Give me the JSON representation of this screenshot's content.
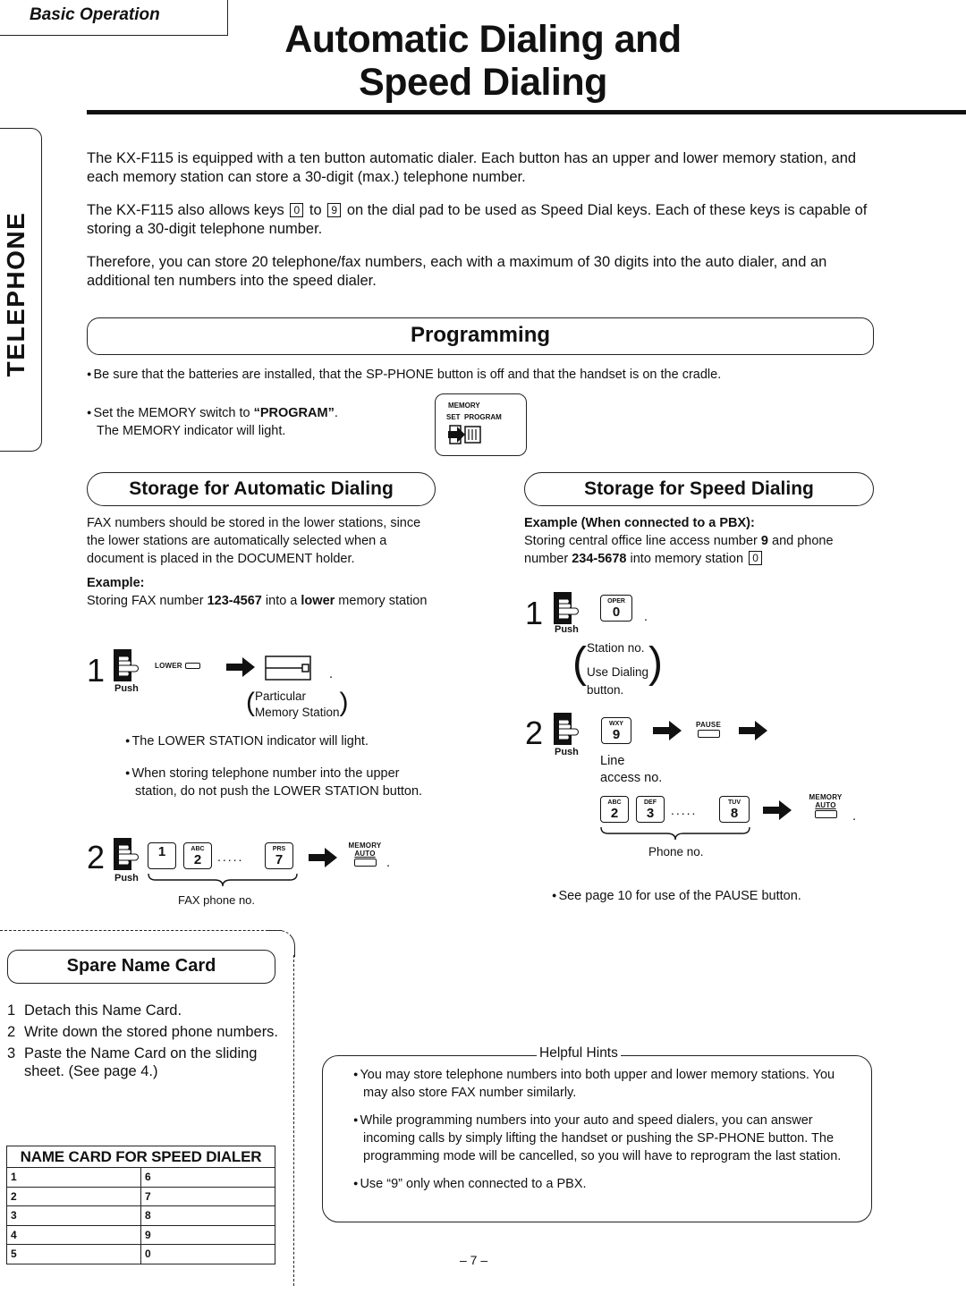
{
  "header": {
    "section_tab": "Basic Operation",
    "title_line1": "Automatic Dialing and",
    "title_line2": "Speed Dialing",
    "side_tab": "TELEPHONE"
  },
  "intro": {
    "p1": "The KX-F115 is equipped with a ten button automatic dialer. Each button has an upper and lower memory station, and each memory station can store a 30-digit (max.) telephone number.",
    "p2_before": "The KX-F115 also allows keys",
    "p2_key_from": "0",
    "p2_mid": "to",
    "p2_key_to": "9",
    "p2_after": "on the dial pad to be used as Speed Dial keys. Each of these keys is capable of storing a 30-digit telephone number.",
    "p3": "Therefore, you can store 20 telephone/fax numbers, each with a maximum of 30 digits into the auto dialer, and an additional ten numbers into the speed dialer."
  },
  "programming": {
    "heading": "Programming",
    "note1": "Be sure that the batteries are installed, that the SP-PHONE button is off and that the handset is on the cradle.",
    "note2_before": "Set the MEMORY switch to ",
    "note2_bold": "“PROGRAM”",
    "note2_after": ".",
    "note2_line2": "The MEMORY indicator will light.",
    "switch_label": "MEMORY",
    "switch_set": "SET",
    "switch_program": "PROGRAM"
  },
  "auto_dialing": {
    "heading": "Storage for Automatic Dialing",
    "description": "FAX numbers should be stored in the lower stations, since the lower stations are automatically selected when a document is placed in the DOCUMENT holder.",
    "example_label": "Example:",
    "example_before": "Storing FAX number ",
    "example_number": "123-4567",
    "example_mid": " into a ",
    "example_bold2": "lower",
    "example_after": " memory station",
    "step1": {
      "num": "1",
      "push": "Push",
      "lower_label": "LOWER",
      "paren_line1": "Particular",
      "paren_line2": "Memory Station"
    },
    "bullets": [
      "The LOWER STATION indicator will light.",
      "When storing telephone number into the upper station, do not push the LOWER STATION button."
    ],
    "step2": {
      "num": "2",
      "push": "Push",
      "keys": [
        {
          "sub": "",
          "main": "1"
        },
        {
          "sub": "ABC",
          "main": "2"
        },
        {
          "sub": "PRS",
          "main": "7"
        }
      ],
      "dots": ".....",
      "memory_label": "MEMORY",
      "auto_label": "AUTO",
      "brace_label": "FAX phone no."
    }
  },
  "speed_dialing": {
    "heading": "Storage for Speed Dialing",
    "example_label": "Example (When connected to a PBX):",
    "example_before": "Storing central office line access number ",
    "example_bold1": "9",
    "example_mid1": " and phone number ",
    "example_bold2": "234-5678",
    "example_mid2": " into memory station",
    "example_key": "0",
    "step1": {
      "num": "1",
      "push": "Push",
      "key_sub": "OPER",
      "key_main": "0",
      "paren_line1": "Station no.",
      "paren_line2": "Use Dialing",
      "paren_line3": "button."
    },
    "step2": {
      "num": "2",
      "push": "Push",
      "key_sub": "WXY",
      "key_main": "9",
      "pause_label": "PAUSE",
      "line_access_1": "Line",
      "line_access_2": "access no.",
      "keys": [
        {
          "sub": "ABC",
          "main": "2"
        },
        {
          "sub": "DEF",
          "main": "3"
        },
        {
          "sub": "TUV",
          "main": "8"
        }
      ],
      "dots": ".....",
      "memory_label": "MEMORY",
      "auto_label": "AUTO",
      "brace_label": "Phone no."
    },
    "note": "See page 10  for use of the PAUSE button."
  },
  "spare_card": {
    "heading": "Spare Name Card",
    "steps": [
      {
        "num": "1",
        "text": "Detach this Name Card."
      },
      {
        "num": "2",
        "text": "Write down the stored phone numbers."
      },
      {
        "num": "3",
        "text": "Paste the Name Card on the sliding sheet. (See page 4.)"
      }
    ],
    "table_title": "NAME CARD FOR SPEED DIALER",
    "table_rows": [
      [
        "1",
        "6"
      ],
      [
        "2",
        "7"
      ],
      [
        "3",
        "8"
      ],
      [
        "4",
        "9"
      ],
      [
        "5",
        "0"
      ]
    ]
  },
  "hints": {
    "title": "Helpful Hints",
    "items": [
      "You may store telephone numbers into both upper and lower memory stations. You may also store FAX number similarly.",
      "While programming numbers into your auto and speed dialers, you can answer incoming calls by simply lifting the handset or pushing the SP-PHONE button. The programming mode will be cancelled, so you will have to reprogram the last station.",
      "Use “9” only when connected to a PBX."
    ]
  },
  "footer": {
    "page_number": "– 7 –"
  }
}
